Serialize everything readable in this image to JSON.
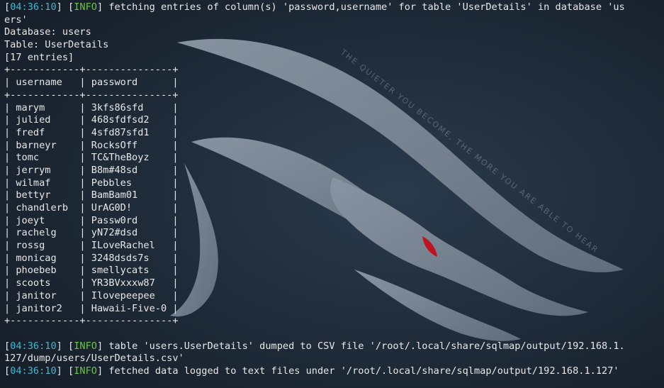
{
  "colors": {
    "background": "#1c2633",
    "text": "#e8e8e8",
    "timestamp": "#3fb8d4",
    "info_tag": "#6cc24a",
    "dragon": "#8a95a3",
    "dragon_eye": "#c0111f"
  },
  "background_art": {
    "icon": "kali-dragon-icon",
    "tagline": "THE QUIETER YOU BECOME, THE MORE YOU ARE ABLE TO HEAR"
  },
  "log_top": {
    "time": "04:36:10",
    "level": "INFO",
    "message_line1": " fetching entries of column(s) 'password,username' for table 'UserDetails' in database 'us",
    "message_line2": "ers'"
  },
  "dump": {
    "database_line": "Database: users",
    "table_line": "Table: UserDetails",
    "entries_line": "[17 entries]",
    "border": "+------------+---------------+",
    "header_row": "| username   | password      |",
    "rows": [
      "| marym      | 3kfs86sfd     |",
      "| julied     | 468sfdfsd2    |",
      "| fredf      | 4sfd87sfd1    |",
      "| barneyr    | RocksOff      |",
      "| tomc       | TC&TheBoyz    |",
      "| jerrym     | B8m#48sd      |",
      "| wilmaf     | Pebbles       |",
      "| bettyr     | BamBam01      |",
      "| chandlerb  | UrAG0D!       |",
      "| joeyt      | Passw0rd      |",
      "| rachelg    | yN72#dsd      |",
      "| rossg      | ILoveRachel   |",
      "| monicag    | 3248dsds7s    |",
      "| phoebeb    | smellycats    |",
      "| scoots     | YR3BVxxxw87   |",
      "| janitor    | Ilovepeepee   |",
      "| janitor2   | Hawaii-Five-0 |"
    ]
  },
  "log_bottom": [
    {
      "time": "04:36:10",
      "level": "INFO",
      "message_line1": " table 'users.UserDetails' dumped to CSV file '/root/.local/share/sqlmap/output/192.168.1.",
      "message_line2": "127/dump/users/UserDetails.csv'"
    },
    {
      "time": "04:36:10",
      "level": "INFO",
      "message_line1": " fetched data logged to text files under '/root/.local/share/sqlmap/output/192.168.1.127'"
    }
  ]
}
